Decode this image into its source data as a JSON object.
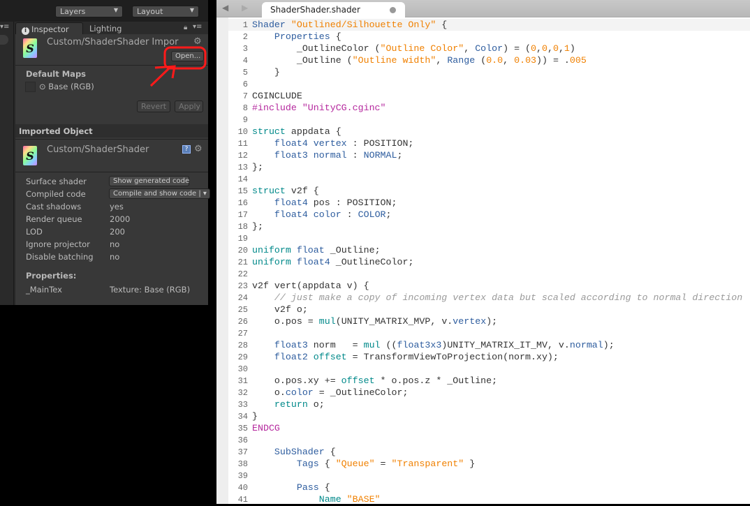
{
  "toolbar": {
    "layers": "Layers",
    "layout": "Layout"
  },
  "inspector": {
    "tabs": [
      "Inspector",
      "Lighting"
    ],
    "importer_title": "Custom/ShaderShader Impor",
    "open_button": "Open...",
    "default_maps": "Default Maps",
    "base_map": "⊙ Base (RGB)",
    "revert": "Revert",
    "apply": "Apply",
    "imported_object": "Imported Object",
    "object_title": "Custom/ShaderShader",
    "rows": [
      {
        "label": "Surface shader",
        "value": "Show generated code"
      },
      {
        "label": "Compiled code",
        "value": "Compile and show code | ▾"
      },
      {
        "label": "Cast shadows",
        "value": "yes"
      },
      {
        "label": "Render queue",
        "value": "2000"
      },
      {
        "label": "LOD",
        "value": "200"
      },
      {
        "label": "Ignore projector",
        "value": "no"
      },
      {
        "label": "Disable batching",
        "value": "no"
      }
    ],
    "properties_label": "Properties:",
    "property": {
      "name": "_MainTex",
      "value": "Texture: Base (RGB)"
    }
  },
  "editor": {
    "tab": "ShaderShader.shader",
    "lines": [
      [
        [
          "Shader ",
          "k"
        ],
        [
          "\"Outlined/Silhouette Only\"",
          "s"
        ],
        [
          " {",
          "n"
        ]
      ],
      [
        [
          "    Properties ",
          "k"
        ],
        [
          "{",
          "n"
        ]
      ],
      [
        [
          "        _OutlineColor (",
          "n"
        ],
        [
          "\"Outline Color\"",
          "s"
        ],
        [
          ", ",
          "n"
        ],
        [
          "Color",
          "k"
        ],
        [
          ") = (",
          "n"
        ],
        [
          "0",
          "s"
        ],
        [
          ",",
          "n"
        ],
        [
          "0",
          "s"
        ],
        [
          ",",
          "n"
        ],
        [
          "0",
          "s"
        ],
        [
          ",",
          "n"
        ],
        [
          "1",
          "s"
        ],
        [
          ")",
          "n"
        ]
      ],
      [
        [
          "        _Outline (",
          "n"
        ],
        [
          "\"Outline width\"",
          "s"
        ],
        [
          ", ",
          "n"
        ],
        [
          "Range",
          "k"
        ],
        [
          " (",
          "n"
        ],
        [
          "0.0",
          "s"
        ],
        [
          ", ",
          "n"
        ],
        [
          "0.03",
          "s"
        ],
        [
          ")) = .",
          "n"
        ],
        [
          "005",
          "s"
        ]
      ],
      [
        [
          "    }",
          "n"
        ]
      ],
      [],
      [
        [
          "CGINCLUDE",
          "n"
        ]
      ],
      [
        [
          "#include \"UnityCG.cginc\"",
          "p"
        ]
      ],
      [],
      [
        [
          "struct ",
          "f"
        ],
        [
          "appdata {",
          "n"
        ]
      ],
      [
        [
          "    float4 vertex",
          "k"
        ],
        [
          " : POSITION;",
          "n"
        ]
      ],
      [
        [
          "    float3 normal",
          "k"
        ],
        [
          " : ",
          "n"
        ],
        [
          "NORMAL",
          "k"
        ],
        [
          ";",
          "n"
        ]
      ],
      [
        [
          "};",
          "n"
        ]
      ],
      [],
      [
        [
          "struct ",
          "f"
        ],
        [
          "v2f {",
          "n"
        ]
      ],
      [
        [
          "    float4",
          "k"
        ],
        [
          " pos : POSITION;",
          "n"
        ]
      ],
      [
        [
          "    float4 color",
          "k"
        ],
        [
          " : ",
          "n"
        ],
        [
          "COLOR",
          "k"
        ],
        [
          ";",
          "n"
        ]
      ],
      [
        [
          "};",
          "n"
        ]
      ],
      [],
      [
        [
          "uniform ",
          "f"
        ],
        [
          "float",
          "k"
        ],
        [
          " _Outline;",
          "n"
        ]
      ],
      [
        [
          "uniform ",
          "f"
        ],
        [
          "float4",
          "k"
        ],
        [
          " _OutlineColor;",
          "n"
        ]
      ],
      [],
      [
        [
          "v2f vert(appdata v) {",
          "n"
        ]
      ],
      [
        [
          "    // just make a copy of incoming vertex data but scaled according to normal direction",
          "c"
        ]
      ],
      [
        [
          "    v2f o;",
          "n"
        ]
      ],
      [
        [
          "    o.pos = ",
          "n"
        ],
        [
          "mul",
          "f"
        ],
        [
          "(UNITY_MATRIX_MVP, v.",
          "n"
        ],
        [
          "vertex",
          "k"
        ],
        [
          ");",
          "n"
        ]
      ],
      [],
      [
        [
          "    float3",
          "k"
        ],
        [
          " norm   = ",
          "n"
        ],
        [
          "mul",
          "f"
        ],
        [
          " ((",
          "n"
        ],
        [
          "float3x3",
          "k"
        ],
        [
          ")UNITY_MATRIX_IT_MV, v.",
          "n"
        ],
        [
          "normal",
          "k"
        ],
        [
          ");",
          "n"
        ]
      ],
      [
        [
          "    float2 ",
          "k"
        ],
        [
          "offset",
          "f"
        ],
        [
          " = TransformViewToProjection(norm.xy);",
          "n"
        ]
      ],
      [],
      [
        [
          "    o.pos.xy += ",
          "n"
        ],
        [
          "offset",
          "f"
        ],
        [
          " * o.pos.z * _Outline;",
          "n"
        ]
      ],
      [
        [
          "    o.",
          "n"
        ],
        [
          "color",
          "k"
        ],
        [
          " = _OutlineColor;",
          "n"
        ]
      ],
      [
        [
          "    return",
          "f"
        ],
        [
          " o;",
          "n"
        ]
      ],
      [
        [
          "}",
          "n"
        ]
      ],
      [
        [
          "ENDCG",
          "p"
        ]
      ],
      [],
      [
        [
          "    SubShader ",
          "k"
        ],
        [
          "{",
          "n"
        ]
      ],
      [
        [
          "        Tags ",
          "k"
        ],
        [
          "{ ",
          "n"
        ],
        [
          "\"Queue\"",
          "s"
        ],
        [
          " = ",
          "n"
        ],
        [
          "\"Transparent\"",
          "s"
        ],
        [
          " }",
          "n"
        ]
      ],
      [],
      [
        [
          "        Pass ",
          "k"
        ],
        [
          "{",
          "n"
        ]
      ],
      [
        [
          "            Name ",
          "f"
        ],
        [
          "\"BASE\"",
          "s"
        ]
      ]
    ]
  },
  "colors": {
    "annotation": "#ff1a1a",
    "keyword": "#2d5c9e",
    "string": "#f08000"
  }
}
